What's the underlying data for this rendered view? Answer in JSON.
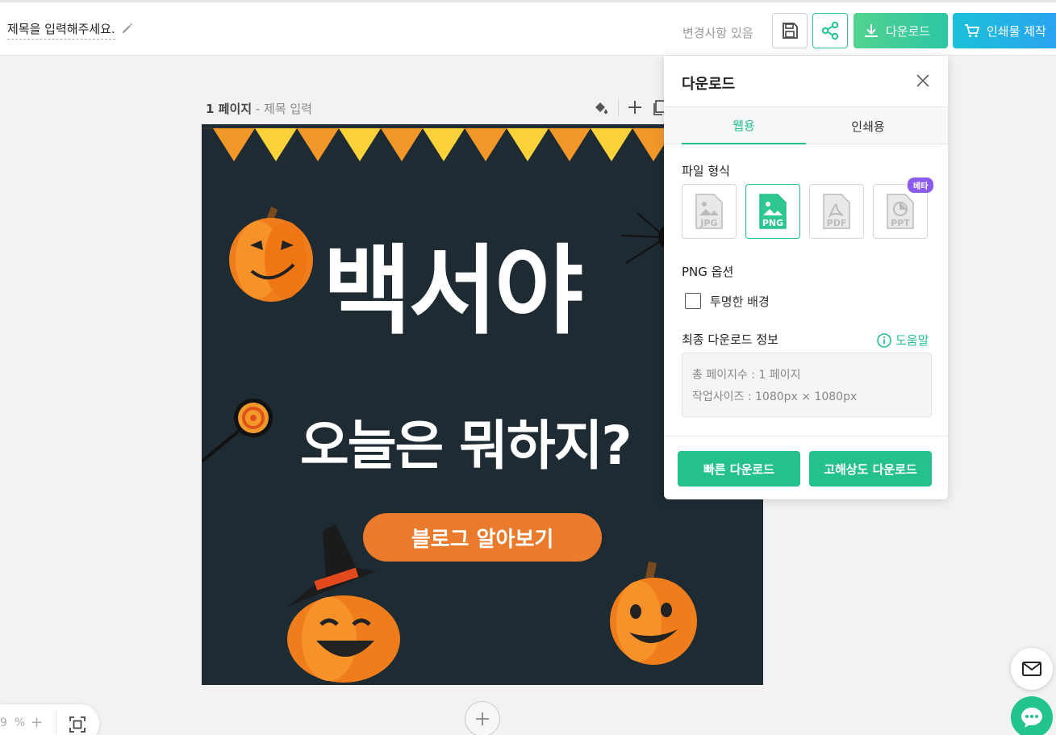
{
  "topbar": {
    "title": "제목을 입력해주세요.",
    "changes_status": "변경사항 있음",
    "download_label": "다운로드",
    "print_label": "인쇄물 제작"
  },
  "page": {
    "number_label": "1 페이지",
    "title_sep": " - ",
    "title_placeholder": "제목 입력"
  },
  "canvas": {
    "headline": "백서야",
    "subline": "오늘은 뭐하지?",
    "cta": "블로그 알아보기",
    "background_color": "#1e2b32"
  },
  "download_panel": {
    "title": "다운로드",
    "tabs": [
      "웹용",
      "인쇄용"
    ],
    "active_tab": "웹용",
    "file_format_label": "파일 형식",
    "formats": [
      "JPG",
      "PNG",
      "PDF",
      "PPT"
    ],
    "selected_format": "PNG",
    "beta_badge": "베타",
    "options_label": "PNG 옵션",
    "transparent_label": "투명한 배경",
    "transparent_checked": false,
    "final_info_label": "최종 다운로드 정보",
    "help_label": "도움말",
    "info_pages": "총 페이지수 : 1 페이지",
    "info_size": "작업사이즈 : 1080px × 1080px",
    "quick_download": "빠른 다운로드",
    "hires_download": "고해상도 다운로드"
  },
  "zoom": {
    "value": "9",
    "unit": "%",
    "plus": "+"
  },
  "colors": {
    "accent": "#24c28a",
    "print_blue": "#2aa4f0",
    "beta_purple": "#8c5cf0",
    "cta_orange": "#ea7a2c"
  }
}
